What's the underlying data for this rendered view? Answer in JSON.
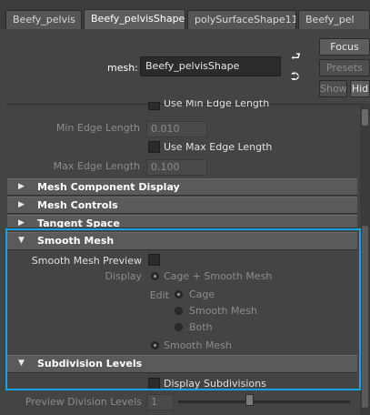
{
  "tabs": [
    {
      "label": "Beefy_pelvis"
    },
    {
      "label": "Beefy_pelvisShape"
    },
    {
      "label": "polySurfaceShape11"
    },
    {
      "label": "Beefy_pel"
    }
  ],
  "header": {
    "mesh_label": "mesh:",
    "mesh_value": "Beefy_pelvisShape",
    "focus_label": "Focus",
    "presets_label": "Presets",
    "show_label": "Show",
    "hide_label": "Hid"
  },
  "panel": {
    "use_min_edge_label": "Use Min Edge Length",
    "min_edge_label": "Min Edge Length",
    "min_edge_value": "0.010",
    "use_max_edge_label": "Use Max Edge Length",
    "max_edge_label": "Max Edge Length",
    "max_edge_value": "0.100",
    "sections": {
      "mesh_component_display": "Mesh Component Display",
      "mesh_controls": "Mesh Controls",
      "tangent_space": "Tangent Space",
      "smooth_mesh": "Smooth Mesh",
      "subdivision_levels": "Subdivision Levels"
    },
    "smooth_mesh_preview_label": "Smooth Mesh Preview",
    "display_label": "Display",
    "display_options": {
      "cage_smooth": "Cage + Smooth Mesh",
      "smooth": "Smooth Mesh"
    },
    "edit_label": "Edit",
    "edit_options": {
      "cage": "Cage",
      "smooth_mesh": "Smooth Mesh",
      "both": "Both"
    },
    "display_subdivisions_label": "Display Subdivisions",
    "preview_division_levels_label": "Preview Division Levels",
    "preview_division_levels_value": "1"
  },
  "colors": {
    "highlight": "#1aa0e4",
    "background": "#444444"
  }
}
